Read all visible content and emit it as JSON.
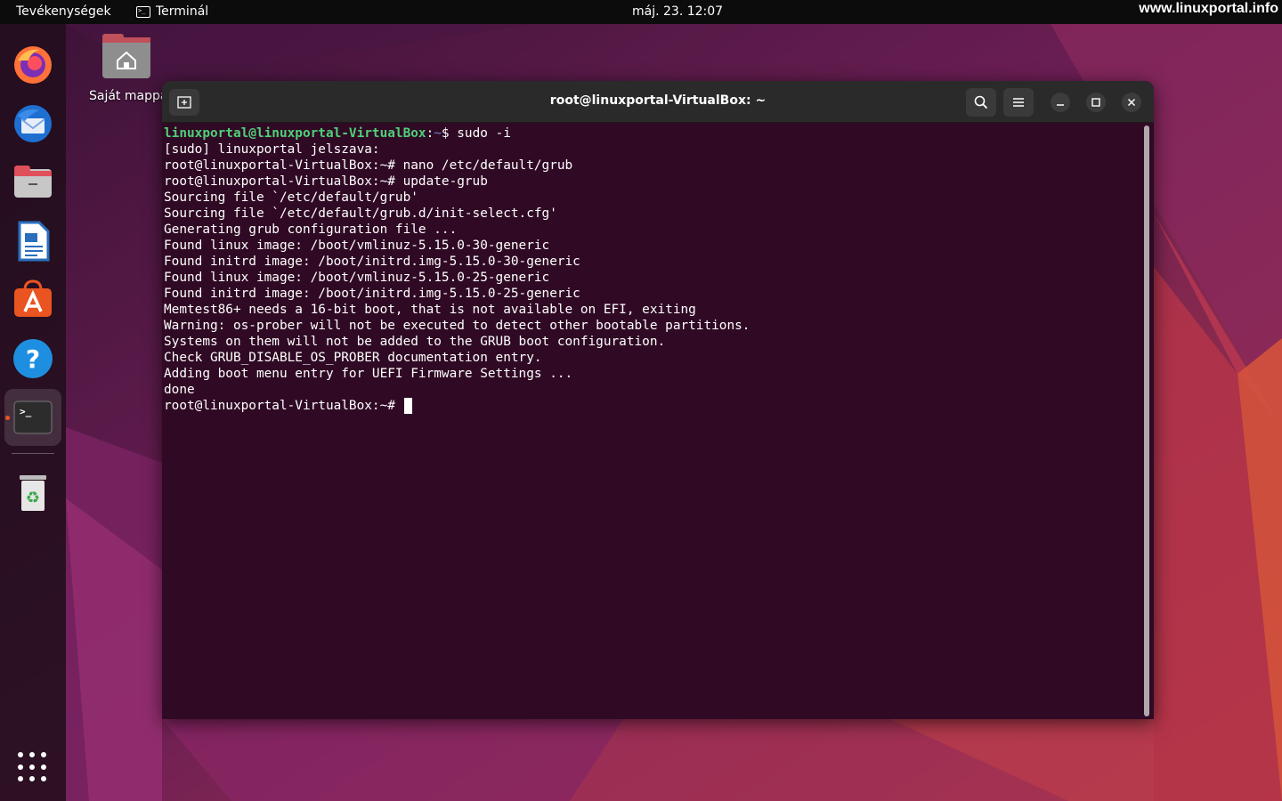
{
  "topbar": {
    "activities": "Tevékenységek",
    "app_name": "Terminál",
    "clock": "máj. 23.  12:07",
    "watermark": "www.linuxportal.info"
  },
  "desktop": {
    "home_folder_label": "Saját mappa"
  },
  "dock": {
    "items": [
      {
        "name": "firefox-icon"
      },
      {
        "name": "thunderbird-icon"
      },
      {
        "name": "files-icon"
      },
      {
        "name": "libreoffice-writer-icon"
      },
      {
        "name": "ubuntu-software-icon"
      },
      {
        "name": "help-icon"
      },
      {
        "name": "terminal-icon",
        "active": true
      },
      {
        "name": "trash-icon"
      }
    ]
  },
  "terminal": {
    "title": "root@linuxportal-VirtualBox: ~",
    "first_prompt_user": "linuxportal@linuxportal-VirtualBox",
    "first_prompt_sep": ":",
    "first_prompt_path": "~",
    "first_prompt_symbol": "$ ",
    "first_command": "sudo -i",
    "lines": [
      "[sudo] linuxportal jelszava:",
      "root@linuxportal-VirtualBox:~# nano /etc/default/grub",
      "root@linuxportal-VirtualBox:~# update-grub",
      "Sourcing file `/etc/default/grub'",
      "Sourcing file `/etc/default/grub.d/init-select.cfg'",
      "Generating grub configuration file ...",
      "Found linux image: /boot/vmlinuz-5.15.0-30-generic",
      "Found initrd image: /boot/initrd.img-5.15.0-30-generic",
      "Found linux image: /boot/vmlinuz-5.15.0-25-generic",
      "Found initrd image: /boot/initrd.img-5.15.0-25-generic",
      "Memtest86+ needs a 16-bit boot, that is not available on EFI, exiting",
      "Warning: os-prober will not be executed to detect other bootable partitions.",
      "Systems on them will not be added to the GRUB boot configuration.",
      "Check GRUB_DISABLE_OS_PROBER documentation entry.",
      "Adding boot menu entry for UEFI Firmware Settings ...",
      "done"
    ],
    "last_prompt": "root@linuxportal-VirtualBox:~# "
  },
  "colors": {
    "terminal_bg": "#300a24",
    "prompt_user": "#4fd07a",
    "prompt_path": "#6a86d8",
    "accent": "#e95420"
  }
}
